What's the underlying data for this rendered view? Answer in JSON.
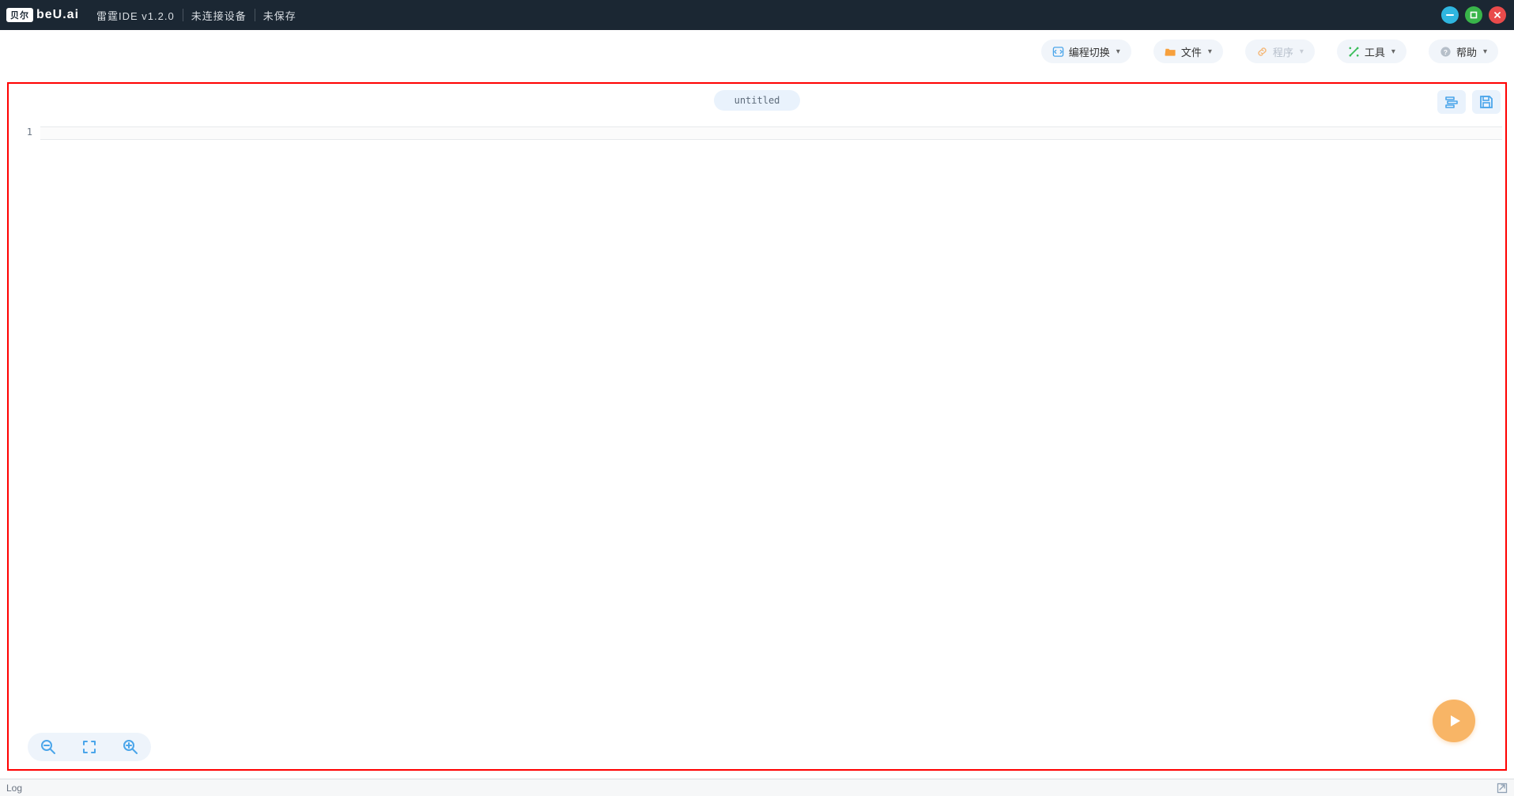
{
  "titlebar": {
    "brand_badge": "贝尔",
    "brand_text": "beU.ai",
    "app_title": "雷霆IDE v1.2.0",
    "connection": "未连接设备",
    "save_state": "未保存"
  },
  "toolbar": {
    "mode_switch": "编程切换",
    "file": "文件",
    "program": "程序",
    "tools": "工具",
    "help": "帮助"
  },
  "tabs": {
    "active": "untitled"
  },
  "editor": {
    "line1_number": "1",
    "line1_text": ""
  },
  "log": {
    "label": "Log"
  },
  "colors": {
    "titlebar_bg": "#1b2733",
    "accent_blue": "#4aa5ea",
    "accent_orange": "#f7a03c",
    "accent_green": "#3bbE5a",
    "run_fab": "#f8b566",
    "border_highlight": "#ff0000"
  }
}
